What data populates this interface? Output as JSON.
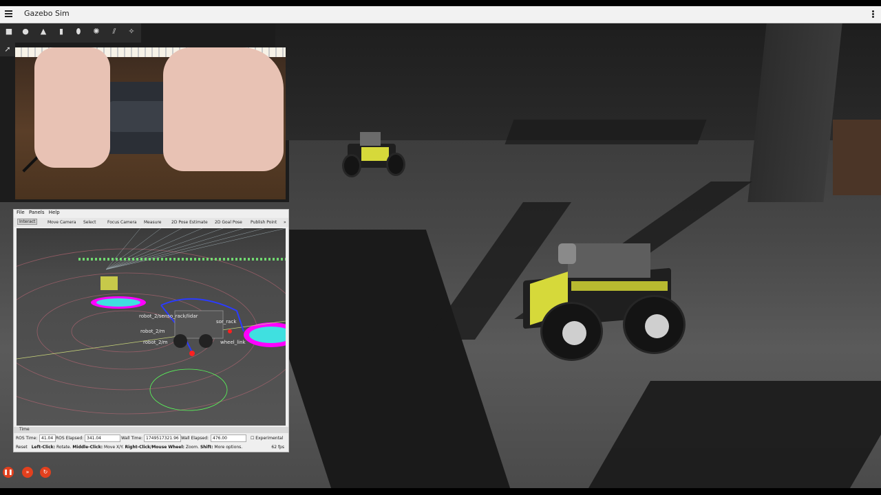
{
  "app": {
    "title": "Gazebo Sim"
  },
  "toolbar": {
    "tools": [
      "box-icon",
      "sphere-icon",
      "cone-icon",
      "cylinder-icon",
      "capsule-icon",
      "sun-icon",
      "directional-light-icon",
      "point-light-icon"
    ]
  },
  "rviz": {
    "menu": [
      "File",
      "Panels",
      "Help"
    ],
    "tools": [
      "Interact",
      "Move Camera",
      "Select",
      "Focus Camera",
      "Measure",
      "2D Pose Estimate",
      "2D Goal Pose",
      "Publish Point"
    ],
    "active_tool": "Interact",
    "overflow": "»",
    "labels": {
      "sensor_link": "robot_2/senso_rack/lidar",
      "sensor_rack": "sor_rack",
      "wheel_a": "robot_2/m",
      "wheel_b": "robot_2/m",
      "wheel_link": "wheel_link"
    },
    "time_panel": {
      "title": "Time",
      "ros_time_label": "ROS Time:",
      "ros_time": "41.04",
      "ros_elapsed_label": "ROS Elapsed:",
      "ros_elapsed": "341.04",
      "wall_time_label": "Wall Time:",
      "wall_time": "1749517321.96",
      "wall_elapsed_label": "Wall Elapsed:",
      "wall_elapsed": "476.00",
      "experimental_label": "Experimental"
    },
    "help": {
      "reset": "Reset",
      "left": "Left-Click:",
      "left_desc": "Rotate.",
      "middle": "Middle-Click:",
      "middle_desc": "Move X/Y.",
      "right": "Right-Click/Mouse Wheel:",
      "right_desc": "Zoom.",
      "shift": "Shift:",
      "shift_desc": "More options.",
      "fps": "62 fps"
    }
  },
  "playback": {
    "buttons": [
      "pause-icon",
      "fast-forward-icon",
      "step-icon"
    ]
  },
  "colors": {
    "accent": "#e2401e",
    "robot_yellow": "#d6d93a",
    "highlight": "#33a0ff"
  }
}
